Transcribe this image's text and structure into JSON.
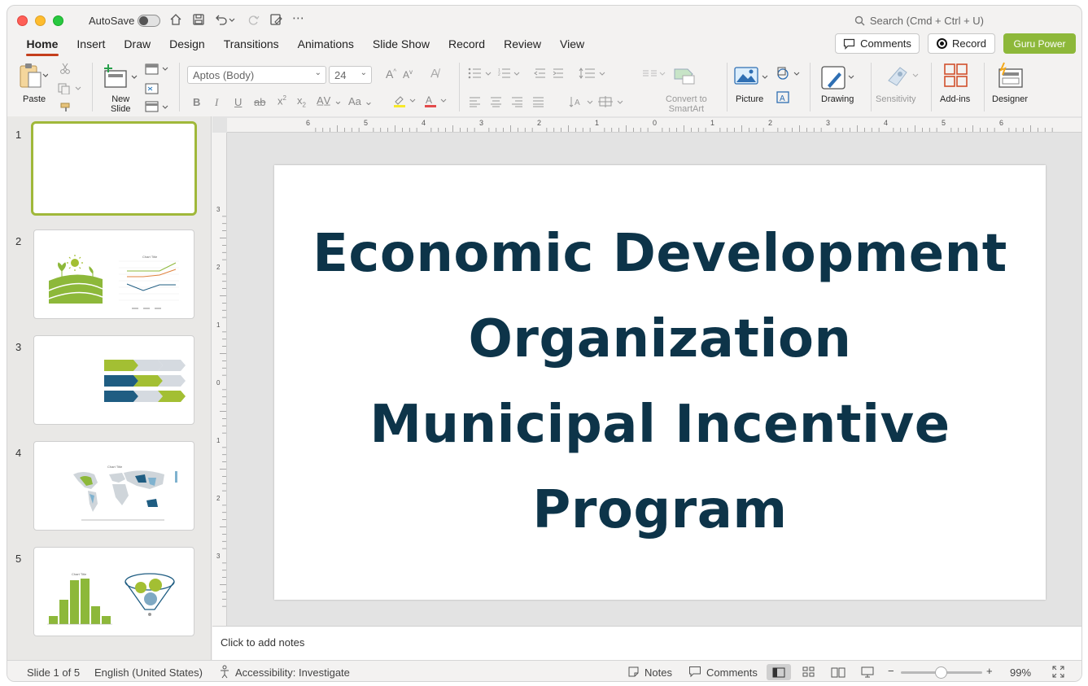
{
  "titlebar": {
    "autosave_label": "AutoSave",
    "search_placeholder": "Search (Cmd + Ctrl + U)"
  },
  "tabs": [
    {
      "label": "Home"
    },
    {
      "label": "Insert"
    },
    {
      "label": "Draw"
    },
    {
      "label": "Design"
    },
    {
      "label": "Transitions"
    },
    {
      "label": "Animations"
    },
    {
      "label": "Slide Show"
    },
    {
      "label": "Record"
    },
    {
      "label": "Review"
    },
    {
      "label": "View"
    }
  ],
  "header_buttons": {
    "comments": "Comments",
    "record": "Record",
    "guru": "Guru Power"
  },
  "ribbon": {
    "paste": "Paste",
    "new_slide_1": "New",
    "new_slide_2": "Slide",
    "font_name": "Aptos (Body)",
    "font_size": "24",
    "convert_1": "Convert to",
    "convert_2": "SmartArt",
    "picture": "Picture",
    "drawing": "Drawing",
    "sensitivity": "Sensitivity",
    "addins": "Add-ins",
    "designer": "Designer"
  },
  "slides": [
    {
      "number": "1"
    },
    {
      "number": "2"
    },
    {
      "number": "3"
    },
    {
      "number": "4"
    },
    {
      "number": "5"
    }
  ],
  "slide": {
    "title_lines": [
      "Economic Development",
      "Organization",
      "Municipal Incentive",
      "Program"
    ]
  },
  "notes": {
    "placeholder": "Click to add notes"
  },
  "status": {
    "slide_count": "Slide 1 of 5",
    "language": "English (United States)",
    "accessibility": "Accessibility: Investigate",
    "notes": "Notes",
    "comments": "Comments",
    "zoom": "99%"
  },
  "ruler": {
    "h_labels": [
      "6",
      "5",
      "4",
      "3",
      "2",
      "1",
      "0",
      "1",
      "2",
      "3",
      "4",
      "5",
      "6"
    ],
    "v_labels": [
      "3",
      "2",
      "1",
      "0",
      "1",
      "2",
      "3"
    ]
  },
  "colors": {
    "accent": "#c43e1c",
    "title_text": "#0d3449",
    "brand_green": "#8db83a"
  }
}
